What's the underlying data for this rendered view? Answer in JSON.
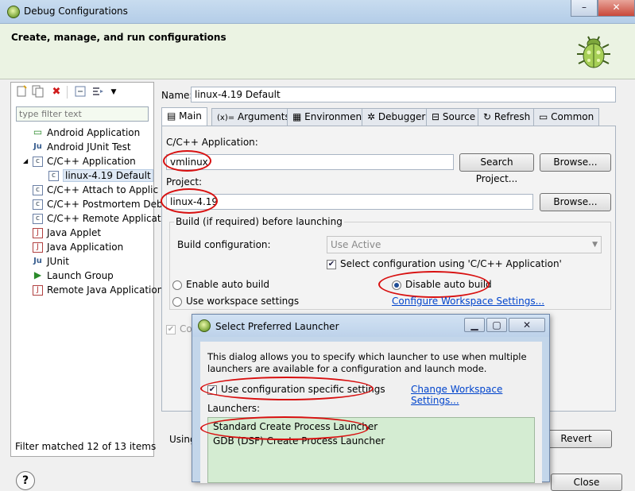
{
  "window": {
    "title": "Debug Configurations",
    "banner_title": "Create, manage, and run configurations",
    "controls": {
      "minimize": "–",
      "close": "✕"
    }
  },
  "left_panel": {
    "filter_placeholder": "type filter text",
    "tree": [
      {
        "label": "Android Application",
        "icon": "android-app-icon",
        "glyph": "▭",
        "level": 1
      },
      {
        "label": "Android JUnit Test",
        "icon": "junit-icon",
        "glyph": "Ju",
        "level": 1
      },
      {
        "label": "C/C++ Application",
        "icon": "c-app-icon",
        "glyph": "c",
        "level": 1,
        "expanded": true
      },
      {
        "label": "linux-4.19 Default",
        "icon": "c-config-icon",
        "glyph": "c",
        "level": 2,
        "selected": true
      },
      {
        "label": "C/C++ Attach to Applic",
        "icon": "c-attach-icon",
        "glyph": "c",
        "level": 1
      },
      {
        "label": "C/C++ Postmortem Deb",
        "icon": "c-postmortem-icon",
        "glyph": "c",
        "level": 1
      },
      {
        "label": "C/C++ Remote Applicat",
        "icon": "c-remote-icon",
        "glyph": "c",
        "level": 1
      },
      {
        "label": "Java Applet",
        "icon": "java-applet-icon",
        "glyph": "J",
        "level": 1
      },
      {
        "label": "Java Application",
        "icon": "java-app-icon",
        "glyph": "J",
        "level": 1
      },
      {
        "label": "JUnit",
        "icon": "junit-icon",
        "glyph": "Ju",
        "level": 1
      },
      {
        "label": "Launch Group",
        "icon": "launch-group-icon",
        "glyph": "▶",
        "level": 1
      },
      {
        "label": "Remote Java Application",
        "icon": "remote-java-icon",
        "glyph": "J",
        "level": 1
      }
    ],
    "filter_status": "Filter matched 12 of 13 items"
  },
  "config": {
    "name_label": "Name:",
    "name_value": "linux-4.19 Default",
    "tabs": [
      {
        "label": "Main",
        "icon": "main-tab-icon",
        "glyph": "▤"
      },
      {
        "label": "Arguments",
        "icon": "arguments-tab-icon",
        "glyph": "(x)="
      },
      {
        "label": "Environment",
        "icon": "environment-tab-icon",
        "glyph": "▦"
      },
      {
        "label": "Debugger",
        "icon": "debugger-tab-icon",
        "glyph": "✲"
      },
      {
        "label": "Source",
        "icon": "source-tab-icon",
        "glyph": "⊟"
      },
      {
        "label": "Refresh",
        "icon": "refresh-tab-icon",
        "glyph": "↻"
      },
      {
        "label": "Common",
        "icon": "common-tab-icon",
        "glyph": "▭"
      }
    ],
    "app_label": "C/C++ Application:",
    "app_value": "vmlinux",
    "search_project_btn": "Search Project...",
    "browse_btn": "Browse...",
    "project_label": "Project:",
    "project_value": "linux-4.19",
    "build_group_label": "Build (if required) before launching",
    "build_config_label": "Build configuration:",
    "build_config_value": "Use Active",
    "select_config_label": "Select configuration using 'C/C++ Application'",
    "enable_auto_build": "Enable auto build",
    "disable_auto_build": "Disable auto build",
    "use_workspace_settings": "Use workspace settings",
    "configure_workspace_link": "Configure Workspace Settings...",
    "partial_checkbox_label": "Co",
    "using_label": "Using",
    "revert_btn": "Revert",
    "close_btn": "Close"
  },
  "dialog": {
    "title": "Select Preferred Launcher",
    "description": "This dialog allows you to specify which launcher to use when multiple launchers are available for a configuration and launch mode.",
    "use_specific_label": "Use configuration specific settings",
    "change_workspace_link": "Change Workspace Settings...",
    "launchers_label": "Launchers:",
    "launchers": [
      "Standard Create Process Launcher",
      "GDB (DSF) Create Process Launcher"
    ],
    "controls": {
      "minimize": "▁",
      "maximize": "▢",
      "close": "✕"
    }
  },
  "help_glyph": "?"
}
